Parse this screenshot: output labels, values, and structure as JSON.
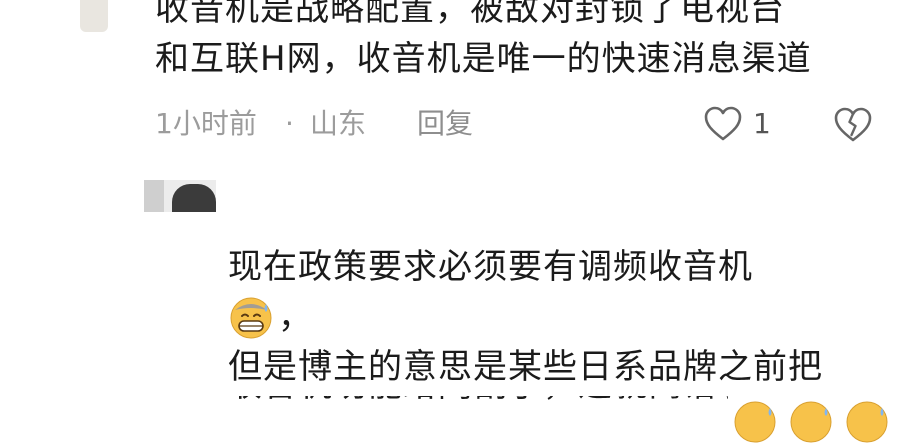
{
  "comment": {
    "lines": [
      "收音机是战略配置，被敌对封锁了电视台",
      "和互联H网，收音机是唯一的快速消息渠道"
    ],
    "time": "1小时前",
    "separator": "·",
    "location": "山东",
    "reply_label": "回复",
    "like_count": "1"
  },
  "reply": {
    "lines": [
      "现在政策要求必须要有调频收音机",
      "，",
      "但是博主的意思是某些日系品牌之前把",
      "收音机功能给阉割了，这就离谱了"
    ]
  },
  "icons": {
    "like": "heart-outline-icon",
    "dislike": "broken-heart-icon",
    "emoji": "grinning-sweat-emoji"
  },
  "colors": {
    "text": "#1b1b1b",
    "meta": "#9c9c9c",
    "emoji_face": "#f7c24a"
  }
}
